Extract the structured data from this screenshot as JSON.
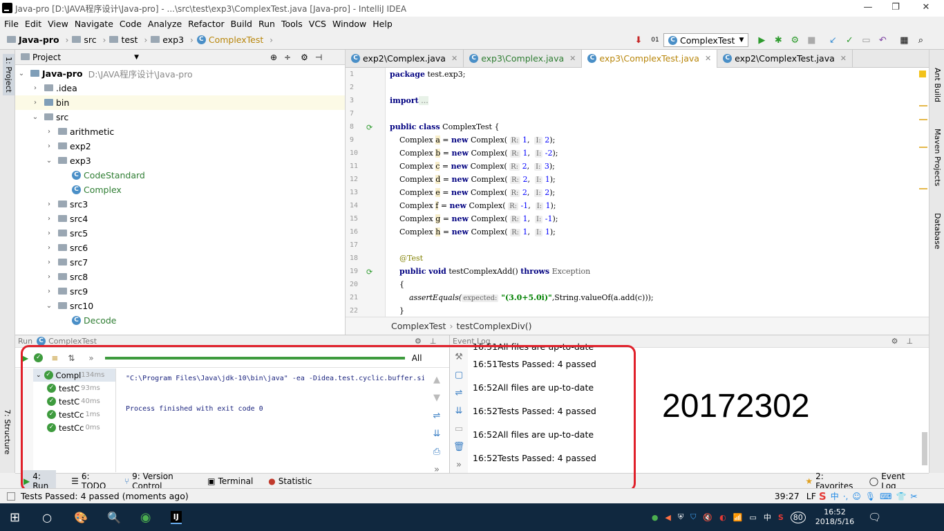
{
  "window": {
    "title": "Java-pro [D:\\JAVA程序设计\\Java-pro] - ...\\src\\test\\exp3\\ComplexTest.java [Java-pro] - IntelliJ IDEA"
  },
  "menu": [
    "File",
    "Edit",
    "View",
    "Navigate",
    "Code",
    "Analyze",
    "Refactor",
    "Build",
    "Run",
    "Tools",
    "VCS",
    "Window",
    "Help"
  ],
  "breadcrumbs": [
    "Java-pro",
    "src",
    "test",
    "exp3",
    "ComplexTest"
  ],
  "run_config": "ComplexTest",
  "left_strip": {
    "project": "1: Project",
    "structure": "7: Structure"
  },
  "right_strip": [
    "Ant Build",
    "Maven Projects",
    "Database"
  ],
  "project": {
    "header": "Project",
    "root": "Java-pro",
    "root_path": "D:\\JAVA程序设计\\Java-pro",
    "items": [
      {
        "label": ".idea",
        "indent": 1,
        "arrow": "›",
        "kind": "folder"
      },
      {
        "label": "bin",
        "indent": 1,
        "arrow": "›",
        "kind": "folder-y",
        "selected": true
      },
      {
        "label": "src",
        "indent": 1,
        "arrow": "⌄",
        "kind": "folder"
      },
      {
        "label": "arithmetic",
        "indent": 2,
        "arrow": "›",
        "kind": "folder"
      },
      {
        "label": "exp2",
        "indent": 2,
        "arrow": "›",
        "kind": "folder"
      },
      {
        "label": "exp3",
        "indent": 2,
        "arrow": "⌄",
        "kind": "folder"
      },
      {
        "label": "CodeStandard",
        "indent": 3,
        "arrow": "",
        "kind": "class"
      },
      {
        "label": "Complex",
        "indent": 3,
        "arrow": "",
        "kind": "class"
      },
      {
        "label": "src3",
        "indent": 2,
        "arrow": "›",
        "kind": "folder"
      },
      {
        "label": "src4",
        "indent": 2,
        "arrow": "›",
        "kind": "folder"
      },
      {
        "label": "src5",
        "indent": 2,
        "arrow": "›",
        "kind": "folder"
      },
      {
        "label": "src6",
        "indent": 2,
        "arrow": "›",
        "kind": "folder"
      },
      {
        "label": "src7",
        "indent": 2,
        "arrow": "›",
        "kind": "folder"
      },
      {
        "label": "src8",
        "indent": 2,
        "arrow": "›",
        "kind": "folder"
      },
      {
        "label": "src9",
        "indent": 2,
        "arrow": "›",
        "kind": "folder"
      },
      {
        "label": "src10",
        "indent": 2,
        "arrow": "⌄",
        "kind": "folder"
      },
      {
        "label": "Decode",
        "indent": 3,
        "arrow": "",
        "kind": "class"
      }
    ]
  },
  "tabs": [
    {
      "label": "exp2\\Complex.java",
      "active": false
    },
    {
      "label": "exp3\\Complex.java",
      "active": false
    },
    {
      "label": "exp3\\ComplexTest.java",
      "active": true
    },
    {
      "label": "exp2\\ComplexTest.java",
      "active": false
    }
  ],
  "line_numbers": [
    "1",
    "2",
    "3",
    "7",
    "8",
    "9",
    "10",
    "11",
    "12",
    "13",
    "14",
    "15",
    "16",
    "17",
    "18",
    "19",
    "20",
    "21",
    "22"
  ],
  "code": {
    "package_kw": "package",
    "package_name": " test.exp3;",
    "import_kw": "import",
    "import_fold": " ...",
    "class_decl_kw": "public class",
    "class_name": " ComplexTest {",
    "fields": [
      {
        "var": "a",
        "r": "1",
        "i": "2"
      },
      {
        "var": "b",
        "r": "1",
        "i": "-2"
      },
      {
        "var": "c",
        "r": "2",
        "i": "3"
      },
      {
        "var": "d",
        "r": "2",
        "i": "1"
      },
      {
        "var": "e",
        "r": "2",
        "i": "2"
      },
      {
        "var": "f",
        "r": "-1",
        "i": "1"
      },
      {
        "var": "g",
        "r": "1",
        "i": "-1"
      },
      {
        "var": "h",
        "r": "1",
        "i": "1"
      }
    ],
    "type": "Complex",
    "new_kw": "new",
    "r_hint": "R:",
    "i_hint": "I:",
    "test_ann": "@Test",
    "method_kw": "public void",
    "method_name": " testComplexAdd() ",
    "throws_kw": "throws",
    "exception": " Exception",
    "open_brace": "{",
    "assert_call": "assertEquals(",
    "expected_hint": "expected:",
    "expected_str": " \"(3.0+5.0i)\"",
    "assert_rest": ",String.valueOf(a.add(c)));",
    "close_brace": "}"
  },
  "editor_breadcrumb": [
    "ComplexTest",
    "testComplexDiv()"
  ],
  "run_panel": {
    "header": "Run",
    "config": "ComplexTest",
    "filter_all": "All",
    "root": {
      "label": "Compl",
      "time": "134ms"
    },
    "tests": [
      {
        "label": "testC",
        "time": "93ms"
      },
      {
        "label": "testC",
        "time": "40ms"
      },
      {
        "label": "testCc",
        "time": "1ms"
      },
      {
        "label": "testCc",
        "time": "0ms"
      }
    ],
    "console": [
      "\"C:\\Program Files\\Java\\jdk-10\\bin\\java\" -ea -Didea.test.cyclic.buffer.si",
      "",
      "Process finished with exit code 0"
    ]
  },
  "event_log": {
    "header": "Event Log",
    "entries": [
      {
        "time": "16:51",
        "msg": "All files are up-to-date"
      },
      {
        "time": "16:51",
        "msg": "Tests Passed: 4 passed"
      },
      {
        "time": "16:52",
        "msg": "All files are up-to-date"
      },
      {
        "time": "16:52",
        "msg": "Tests Passed: 4 passed"
      },
      {
        "time": "16:52",
        "msg": "All files are up-to-date"
      },
      {
        "time": "16:52",
        "msg": "Tests Passed: 4 passed"
      }
    ]
  },
  "student_id": "20172302",
  "bottom_tabs": [
    "4: Run",
    "6: TODO",
    "9: Version Control",
    "Terminal",
    "Statistic"
  ],
  "bottom_right": [
    "2: Favorites",
    "Event Log"
  ],
  "status": {
    "message": "Tests Passed: 4 passed (moments ago)",
    "position": "39:27",
    "encoding": "LF"
  },
  "taskbar": {
    "time": "16:52",
    "date": "2018/5/16",
    "battery": "80",
    "ime": "中"
  },
  "colors": {
    "accent_red": "#e0202a",
    "pass_green": "#3e9b3e"
  }
}
